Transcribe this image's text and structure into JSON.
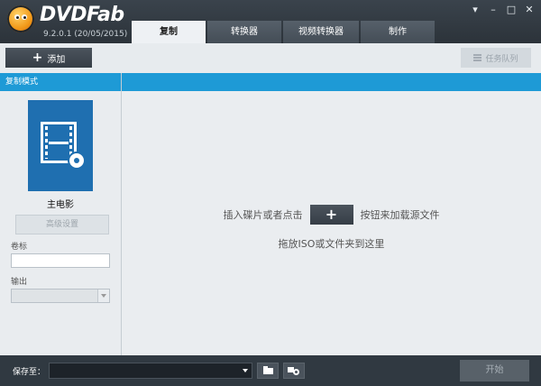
{
  "app": {
    "name": "DVDFab",
    "version": "9.2.0.1 (20/05/2015)"
  },
  "tabs": [
    {
      "label": "复制",
      "active": true
    },
    {
      "label": "转换器",
      "active": false
    },
    {
      "label": "视频转换器",
      "active": false
    },
    {
      "label": "制作",
      "active": false
    }
  ],
  "toolbar": {
    "add_label": "添加",
    "queue_label": "任务队列"
  },
  "left_panel": {
    "mode_header": "复制模式",
    "mode_name": "主电影",
    "advanced_label": "高级设置",
    "volume_label": "卷标",
    "volume_value": "",
    "output_label": "输出",
    "output_value": ""
  },
  "main": {
    "hint_before": "插入碟片或者点击",
    "hint_after": "按钮来加载源文件",
    "hint_drag": "拖放ISO或文件夹到这里"
  },
  "bottom": {
    "save_label": "保存至：",
    "save_value": "",
    "start_label": "开始"
  },
  "colors": {
    "accent": "#1e9ad6",
    "tile": "#1f6fb0",
    "chrome": "#303941"
  }
}
